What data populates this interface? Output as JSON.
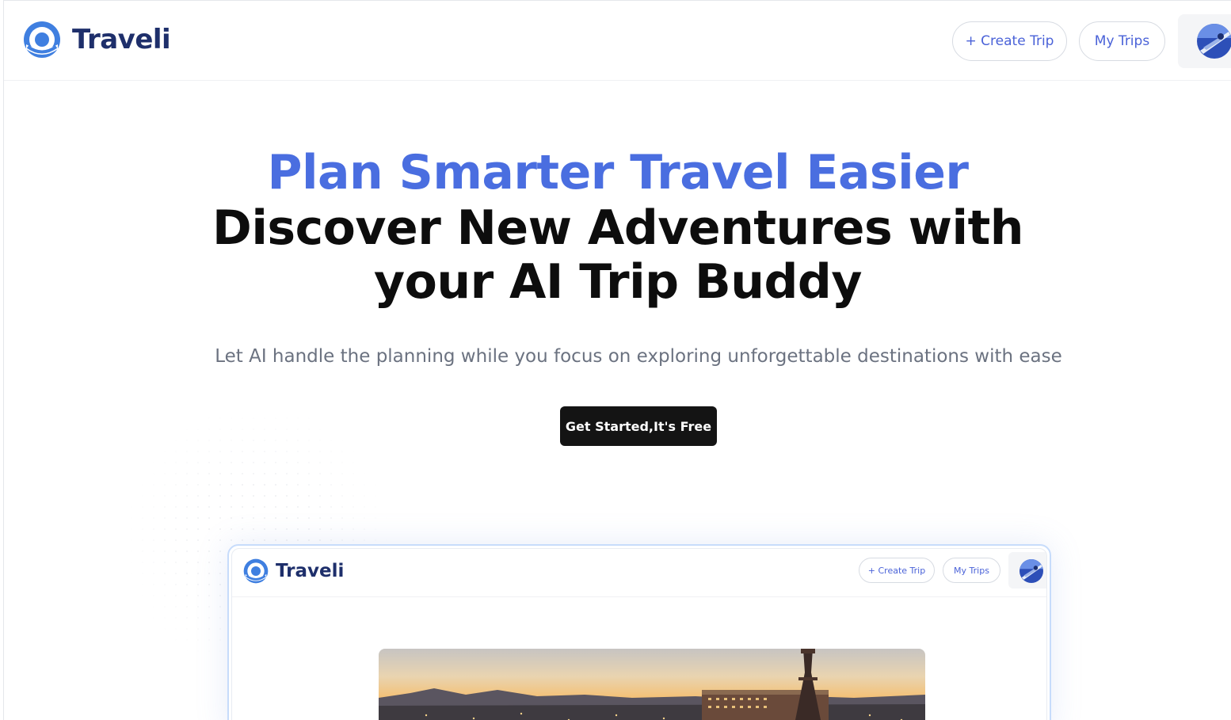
{
  "header": {
    "brand": "Traveli",
    "create_trip_label": "+ Create Trip",
    "my_trips_label": "My Trips"
  },
  "hero": {
    "line1": "Plan Smarter Travel Easier",
    "line2": "Discover New Adventures with",
    "line3": "your AI Trip Buddy",
    "subtitle": "Let AI handle the planning while you focus on exploring unforgettable destinations with ease",
    "cta_label": "Get Started,It's Free"
  },
  "preview": {
    "brand": "Traveli",
    "create_trip_label": "+ Create Trip",
    "my_trips_label": "My Trips"
  },
  "colors": {
    "accent": "#4a6ee0",
    "brand_text": "#1e2f6b",
    "cta_bg": "#141414",
    "pill_text": "#4a62d8"
  },
  "icons": {
    "logo": "traveli-logo-icon",
    "avatar": "user-avatar"
  }
}
